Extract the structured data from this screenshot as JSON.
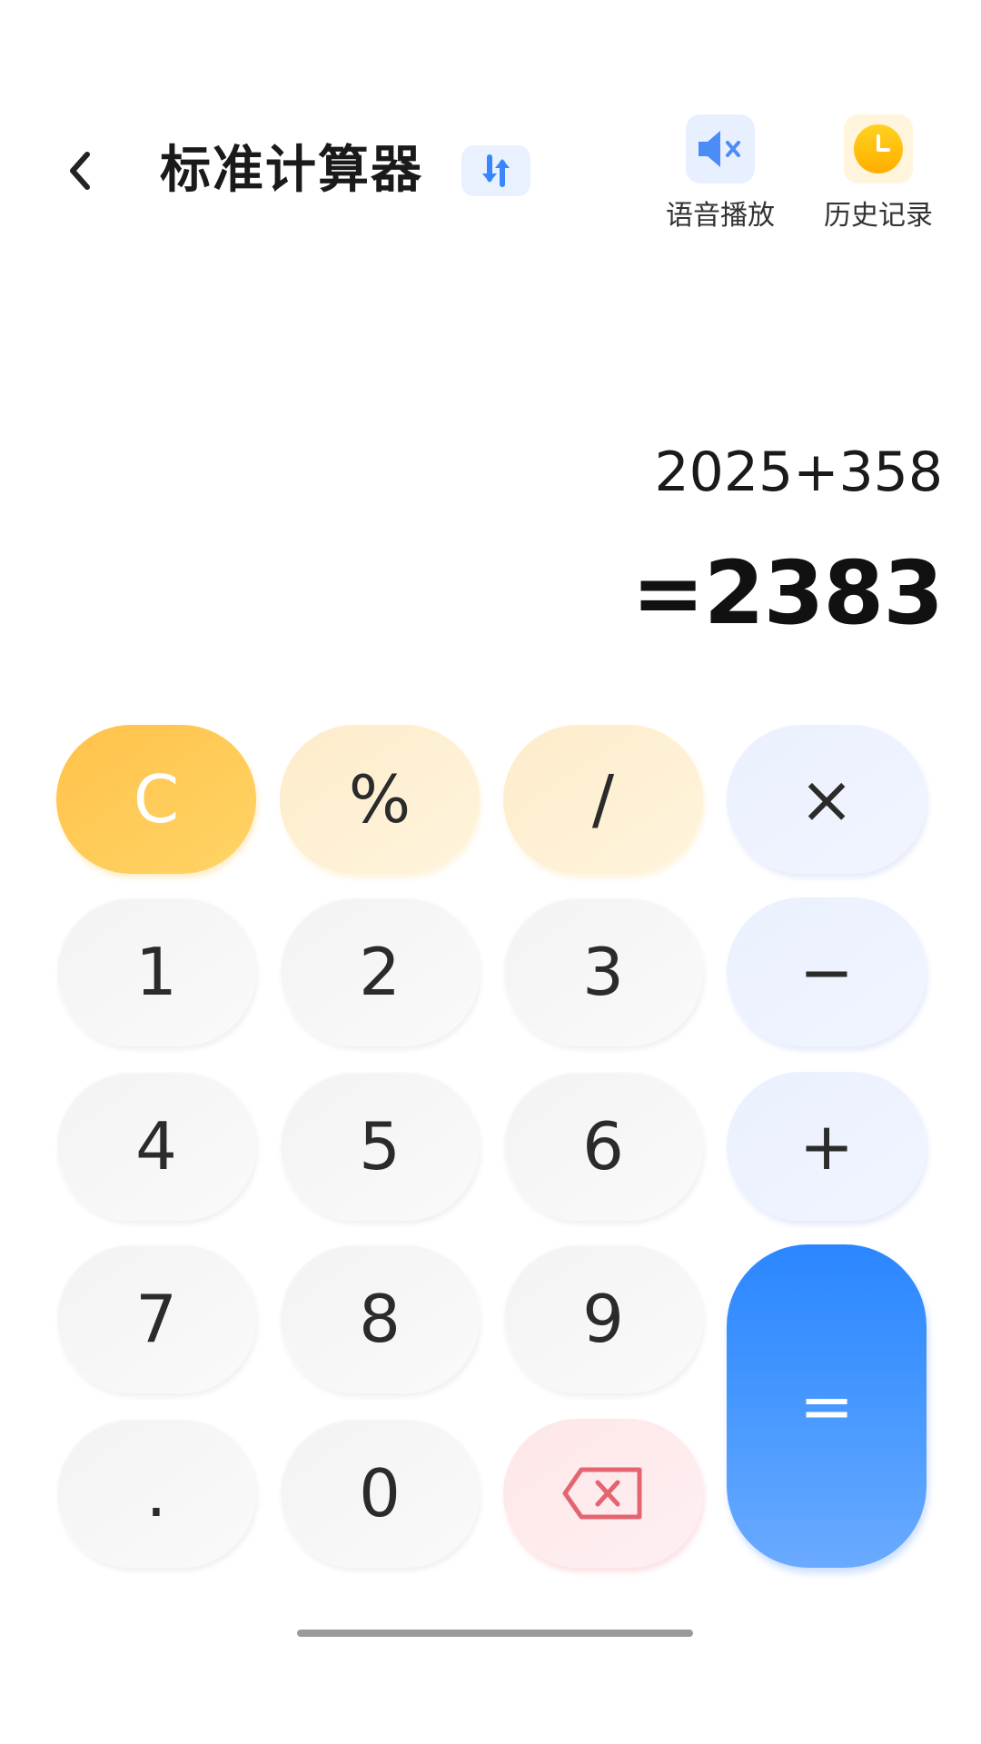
{
  "header": {
    "title": "标准计算器",
    "actions": [
      {
        "label": "语音播放",
        "icon": "speaker-muted-icon"
      },
      {
        "label": "历史记录",
        "icon": "clock-icon"
      }
    ]
  },
  "display": {
    "expression": "2025+358",
    "result": "=2383"
  },
  "keys": {
    "clear": "C",
    "percent": "%",
    "divide": "/",
    "multiply": "×",
    "minus": "−",
    "plus": "+",
    "equals": "=",
    "dot": ".",
    "d0": "0",
    "d1": "1",
    "d2": "2",
    "d3": "3",
    "d4": "4",
    "d5": "5",
    "d6": "6",
    "d7": "7",
    "d8": "8",
    "d9": "9",
    "backspace_icon": "backspace-icon"
  },
  "colors": {
    "accent_blue": "#2b86ff",
    "clear_yellow": "#ffc24a",
    "delete_red": "#e46470"
  }
}
